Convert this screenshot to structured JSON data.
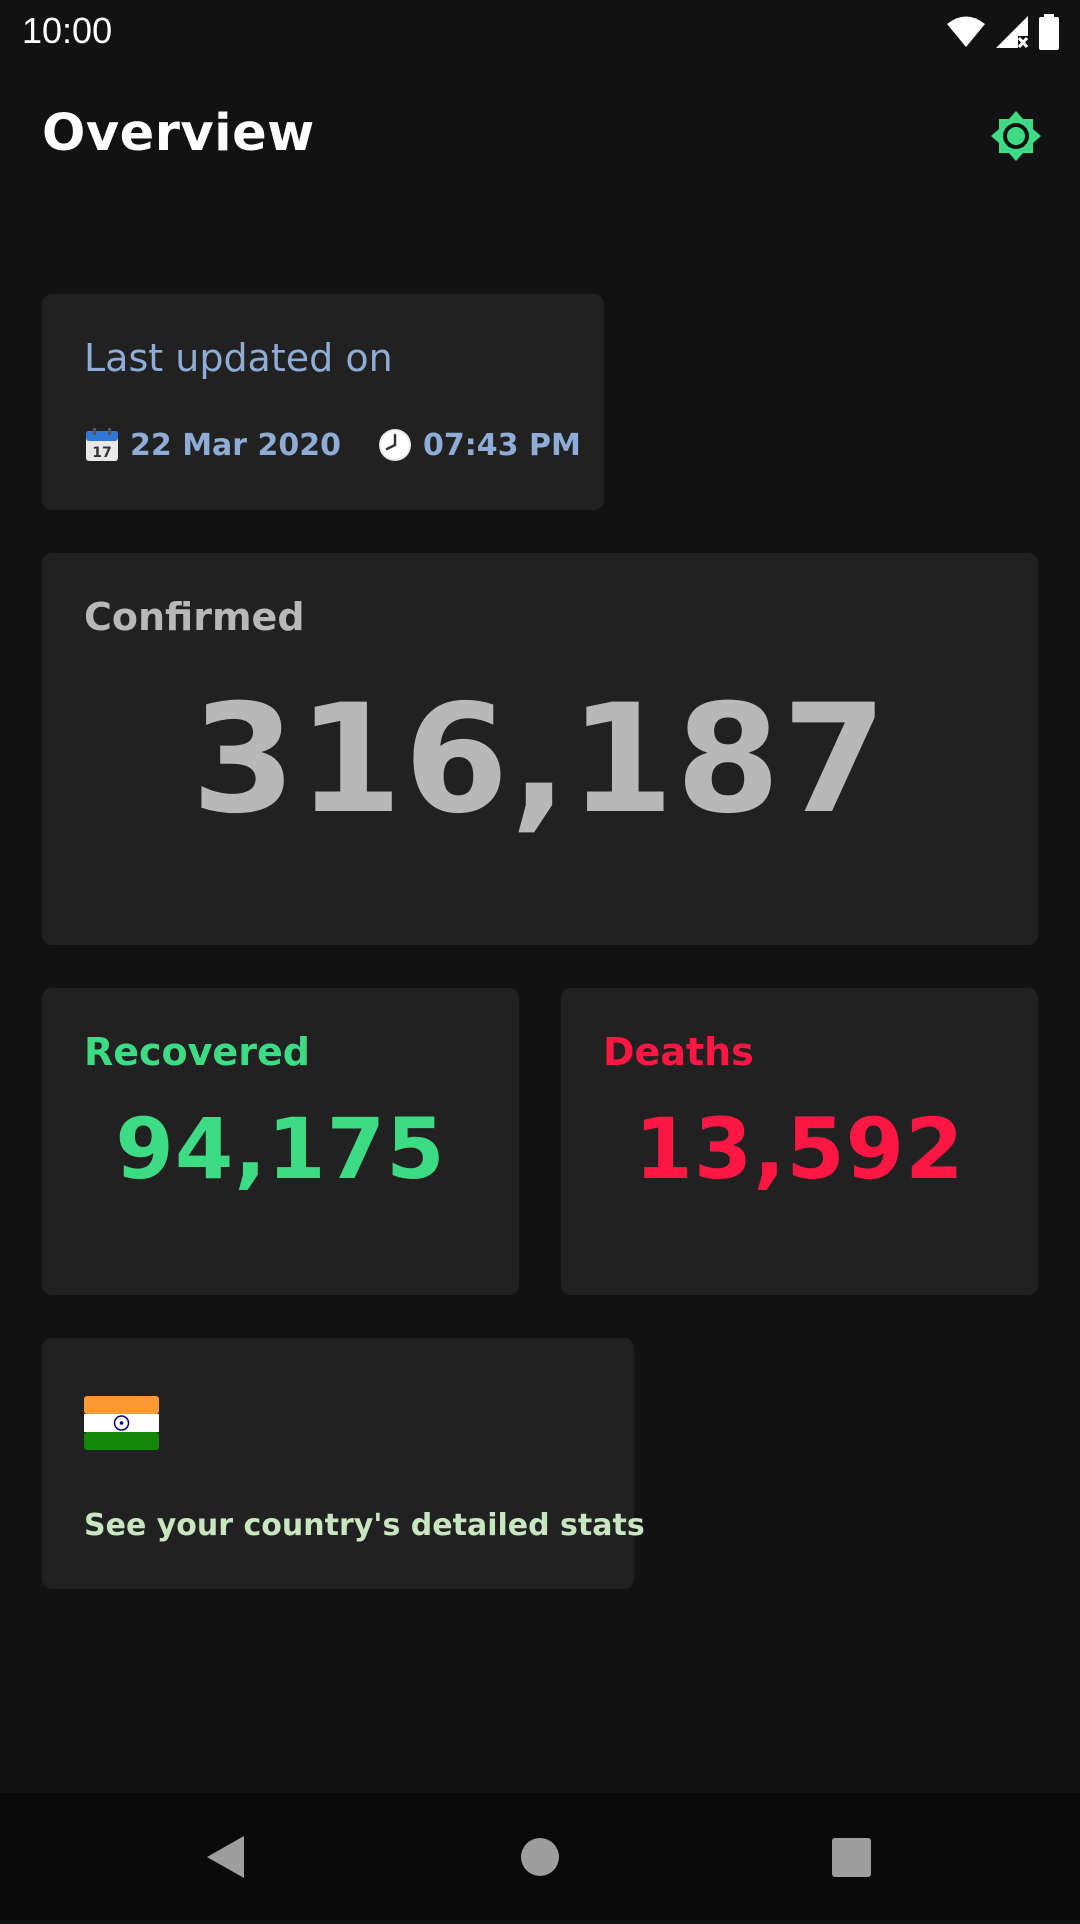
{
  "status_bar": {
    "time": "10:00",
    "icons": [
      "wifi-icon",
      "signal-icon",
      "battery-icon"
    ]
  },
  "header": {
    "title": "Overview",
    "theme_toggle_icon": "brightness-icon",
    "accent_color": "#3ddc84"
  },
  "last_updated": {
    "label": "Last updated on",
    "date": "22 Mar 2020",
    "time": "07:43 PM",
    "date_icon": "calendar-icon",
    "time_icon": "clock-icon",
    "color": "#8eacd6"
  },
  "stats": {
    "confirmed": {
      "label": "Confirmed",
      "value": "316,187",
      "color": "#b8b8b8"
    },
    "recovered": {
      "label": "Recovered",
      "value": "94,175",
      "color": "#3ddc84"
    },
    "deaths": {
      "label": "Deaths",
      "value": "13,592",
      "color": "#ff1744"
    }
  },
  "country_card": {
    "flag_icon": "india-flag-icon",
    "text": "See your country's detailed stats"
  },
  "nav_bar": {
    "buttons": [
      "back-icon",
      "home-icon",
      "recents-icon"
    ]
  }
}
